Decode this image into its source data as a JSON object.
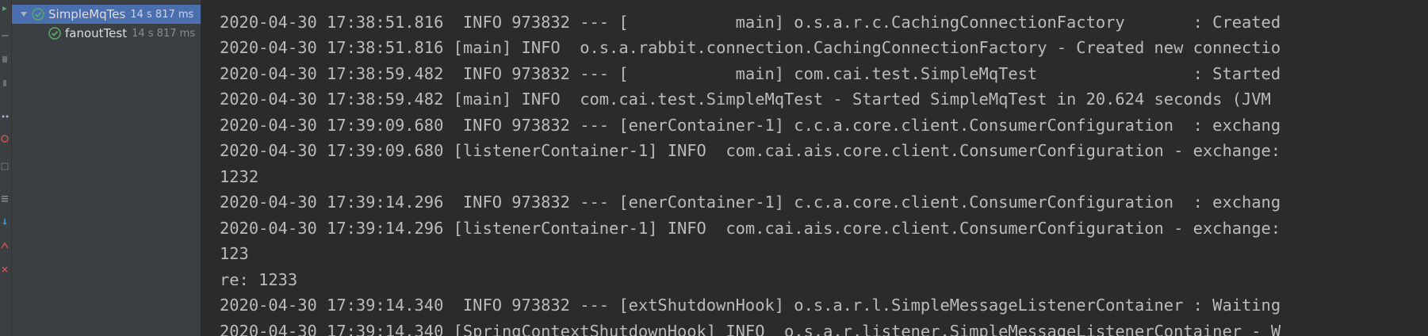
{
  "test_tree": {
    "items": [
      {
        "label": "SimpleMqTes",
        "time": "14 s 817 ms",
        "status": "passed",
        "selected": true
      },
      {
        "label": "fanoutTest",
        "time": "14 s 817 ms",
        "status": "passed",
        "selected": false
      }
    ]
  },
  "console": {
    "lines": [
      "2020-04-30 17:38:51.816  INFO 973832 --- [           main] o.s.a.r.c.CachingConnectionFactory       : Created",
      "2020-04-30 17:38:51.816 [main] INFO  o.s.a.rabbit.connection.CachingConnectionFactory - Created new connectio",
      "2020-04-30 17:38:59.482  INFO 973832 --- [           main] com.cai.test.SimpleMqTest                : Started",
      "2020-04-30 17:38:59.482 [main] INFO  com.cai.test.SimpleMqTest - Started SimpleMqTest in 20.624 seconds (JVM",
      "2020-04-30 17:39:09.680  INFO 973832 --- [enerContainer-1] c.c.a.core.client.ConsumerConfiguration  : exchang",
      "2020-04-30 17:39:09.680 [listenerContainer-1] INFO  com.cai.ais.core.client.ConsumerConfiguration - exchange:",
      "1232",
      "2020-04-30 17:39:14.296  INFO 973832 --- [enerContainer-1] c.c.a.core.client.ConsumerConfiguration  : exchang",
      "2020-04-30 17:39:14.296 [listenerContainer-1] INFO  com.cai.ais.core.client.ConsumerConfiguration - exchange:",
      "123",
      "re: 1233",
      "2020-04-30 17:39:14.340  INFO 973832 --- [extShutdownHook] o.s.a.r.l.SimpleMessageListenerContainer : Waiting",
      "2020-04-30 17:39:14.340 [SpringContextShutdownHook] INFO  o.s.a.r.listener.SimpleMessageListenerContainer - W"
    ]
  },
  "colors": {
    "console_bg": "#2b2b2b",
    "panel_bg": "#3c3f41",
    "selection": "#4b6eaf",
    "passed": "#59a869",
    "text": "#bbbbbb"
  },
  "icons": {
    "expander": "triangle-down-icon",
    "passed": "check-circle-icon"
  }
}
